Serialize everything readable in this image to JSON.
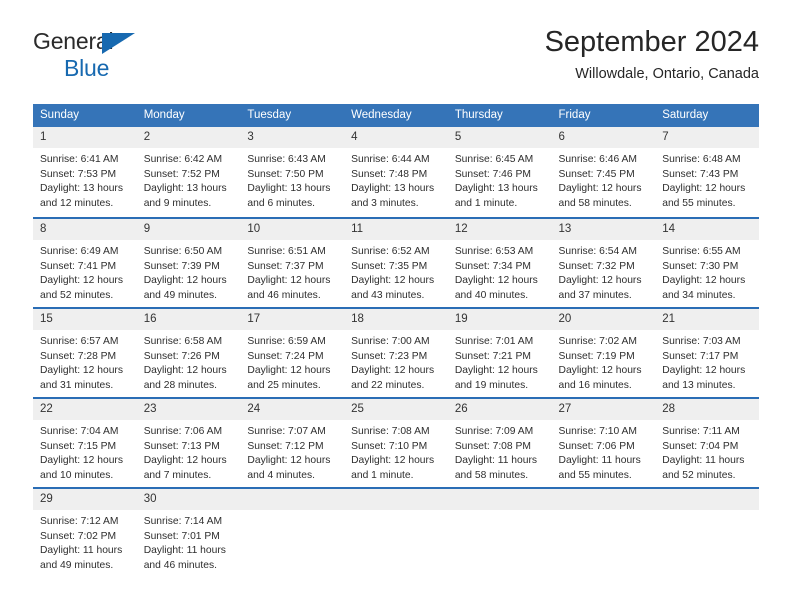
{
  "brand": {
    "name_top": "General",
    "name_bottom": "Blue",
    "flag_icon": "blue-triangle-flag-icon",
    "accent_color": "#1769b0"
  },
  "header": {
    "title": "September 2024",
    "location": "Willowdale, Ontario, Canada"
  },
  "theme": {
    "header_bar_color": "#3574b8",
    "daynum_band_color": "#efefef",
    "daynum_rule_color": "#2a6db5",
    "text_color": "#2e2e2e"
  },
  "calendar": {
    "weekday_headers": [
      "Sunday",
      "Monday",
      "Tuesday",
      "Wednesday",
      "Thursday",
      "Friday",
      "Saturday"
    ],
    "weeks": [
      [
        {
          "day": "1",
          "sunrise": "Sunrise: 6:41 AM",
          "sunset": "Sunset: 7:53 PM",
          "daylight_line1": "Daylight: 13 hours",
          "daylight_line2": "and 12 minutes."
        },
        {
          "day": "2",
          "sunrise": "Sunrise: 6:42 AM",
          "sunset": "Sunset: 7:52 PM",
          "daylight_line1": "Daylight: 13 hours",
          "daylight_line2": "and 9 minutes."
        },
        {
          "day": "3",
          "sunrise": "Sunrise: 6:43 AM",
          "sunset": "Sunset: 7:50 PM",
          "daylight_line1": "Daylight: 13 hours",
          "daylight_line2": "and 6 minutes."
        },
        {
          "day": "4",
          "sunrise": "Sunrise: 6:44 AM",
          "sunset": "Sunset: 7:48 PM",
          "daylight_line1": "Daylight: 13 hours",
          "daylight_line2": "and 3 minutes."
        },
        {
          "day": "5",
          "sunrise": "Sunrise: 6:45 AM",
          "sunset": "Sunset: 7:46 PM",
          "daylight_line1": "Daylight: 13 hours",
          "daylight_line2": "and 1 minute."
        },
        {
          "day": "6",
          "sunrise": "Sunrise: 6:46 AM",
          "sunset": "Sunset: 7:45 PM",
          "daylight_line1": "Daylight: 12 hours",
          "daylight_line2": "and 58 minutes."
        },
        {
          "day": "7",
          "sunrise": "Sunrise: 6:48 AM",
          "sunset": "Sunset: 7:43 PM",
          "daylight_line1": "Daylight: 12 hours",
          "daylight_line2": "and 55 minutes."
        }
      ],
      [
        {
          "day": "8",
          "sunrise": "Sunrise: 6:49 AM",
          "sunset": "Sunset: 7:41 PM",
          "daylight_line1": "Daylight: 12 hours",
          "daylight_line2": "and 52 minutes."
        },
        {
          "day": "9",
          "sunrise": "Sunrise: 6:50 AM",
          "sunset": "Sunset: 7:39 PM",
          "daylight_line1": "Daylight: 12 hours",
          "daylight_line2": "and 49 minutes."
        },
        {
          "day": "10",
          "sunrise": "Sunrise: 6:51 AM",
          "sunset": "Sunset: 7:37 PM",
          "daylight_line1": "Daylight: 12 hours",
          "daylight_line2": "and 46 minutes."
        },
        {
          "day": "11",
          "sunrise": "Sunrise: 6:52 AM",
          "sunset": "Sunset: 7:35 PM",
          "daylight_line1": "Daylight: 12 hours",
          "daylight_line2": "and 43 minutes."
        },
        {
          "day": "12",
          "sunrise": "Sunrise: 6:53 AM",
          "sunset": "Sunset: 7:34 PM",
          "daylight_line1": "Daylight: 12 hours",
          "daylight_line2": "and 40 minutes."
        },
        {
          "day": "13",
          "sunrise": "Sunrise: 6:54 AM",
          "sunset": "Sunset: 7:32 PM",
          "daylight_line1": "Daylight: 12 hours",
          "daylight_line2": "and 37 minutes."
        },
        {
          "day": "14",
          "sunrise": "Sunrise: 6:55 AM",
          "sunset": "Sunset: 7:30 PM",
          "daylight_line1": "Daylight: 12 hours",
          "daylight_line2": "and 34 minutes."
        }
      ],
      [
        {
          "day": "15",
          "sunrise": "Sunrise: 6:57 AM",
          "sunset": "Sunset: 7:28 PM",
          "daylight_line1": "Daylight: 12 hours",
          "daylight_line2": "and 31 minutes."
        },
        {
          "day": "16",
          "sunrise": "Sunrise: 6:58 AM",
          "sunset": "Sunset: 7:26 PM",
          "daylight_line1": "Daylight: 12 hours",
          "daylight_line2": "and 28 minutes."
        },
        {
          "day": "17",
          "sunrise": "Sunrise: 6:59 AM",
          "sunset": "Sunset: 7:24 PM",
          "daylight_line1": "Daylight: 12 hours",
          "daylight_line2": "and 25 minutes."
        },
        {
          "day": "18",
          "sunrise": "Sunrise: 7:00 AM",
          "sunset": "Sunset: 7:23 PM",
          "daylight_line1": "Daylight: 12 hours",
          "daylight_line2": "and 22 minutes."
        },
        {
          "day": "19",
          "sunrise": "Sunrise: 7:01 AM",
          "sunset": "Sunset: 7:21 PM",
          "daylight_line1": "Daylight: 12 hours",
          "daylight_line2": "and 19 minutes."
        },
        {
          "day": "20",
          "sunrise": "Sunrise: 7:02 AM",
          "sunset": "Sunset: 7:19 PM",
          "daylight_line1": "Daylight: 12 hours",
          "daylight_line2": "and 16 minutes."
        },
        {
          "day": "21",
          "sunrise": "Sunrise: 7:03 AM",
          "sunset": "Sunset: 7:17 PM",
          "daylight_line1": "Daylight: 12 hours",
          "daylight_line2": "and 13 minutes."
        }
      ],
      [
        {
          "day": "22",
          "sunrise": "Sunrise: 7:04 AM",
          "sunset": "Sunset: 7:15 PM",
          "daylight_line1": "Daylight: 12 hours",
          "daylight_line2": "and 10 minutes."
        },
        {
          "day": "23",
          "sunrise": "Sunrise: 7:06 AM",
          "sunset": "Sunset: 7:13 PM",
          "daylight_line1": "Daylight: 12 hours",
          "daylight_line2": "and 7 minutes."
        },
        {
          "day": "24",
          "sunrise": "Sunrise: 7:07 AM",
          "sunset": "Sunset: 7:12 PM",
          "daylight_line1": "Daylight: 12 hours",
          "daylight_line2": "and 4 minutes."
        },
        {
          "day": "25",
          "sunrise": "Sunrise: 7:08 AM",
          "sunset": "Sunset: 7:10 PM",
          "daylight_line1": "Daylight: 12 hours",
          "daylight_line2": "and 1 minute."
        },
        {
          "day": "26",
          "sunrise": "Sunrise: 7:09 AM",
          "sunset": "Sunset: 7:08 PM",
          "daylight_line1": "Daylight: 11 hours",
          "daylight_line2": "and 58 minutes."
        },
        {
          "day": "27",
          "sunrise": "Sunrise: 7:10 AM",
          "sunset": "Sunset: 7:06 PM",
          "daylight_line1": "Daylight: 11 hours",
          "daylight_line2": "and 55 minutes."
        },
        {
          "day": "28",
          "sunrise": "Sunrise: 7:11 AM",
          "sunset": "Sunset: 7:04 PM",
          "daylight_line1": "Daylight: 11 hours",
          "daylight_line2": "and 52 minutes."
        }
      ],
      [
        {
          "day": "29",
          "sunrise": "Sunrise: 7:12 AM",
          "sunset": "Sunset: 7:02 PM",
          "daylight_line1": "Daylight: 11 hours",
          "daylight_line2": "and 49 minutes."
        },
        {
          "day": "30",
          "sunrise": "Sunrise: 7:14 AM",
          "sunset": "Sunset: 7:01 PM",
          "daylight_line1": "Daylight: 11 hours",
          "daylight_line2": "and 46 minutes."
        },
        {
          "day": "",
          "sunrise": "",
          "sunset": "",
          "daylight_line1": "",
          "daylight_line2": ""
        },
        {
          "day": "",
          "sunrise": "",
          "sunset": "",
          "daylight_line1": "",
          "daylight_line2": ""
        },
        {
          "day": "",
          "sunrise": "",
          "sunset": "",
          "daylight_line1": "",
          "daylight_line2": ""
        },
        {
          "day": "",
          "sunrise": "",
          "sunset": "",
          "daylight_line1": "",
          "daylight_line2": ""
        },
        {
          "day": "",
          "sunrise": "",
          "sunset": "",
          "daylight_line1": "",
          "daylight_line2": ""
        }
      ]
    ]
  }
}
